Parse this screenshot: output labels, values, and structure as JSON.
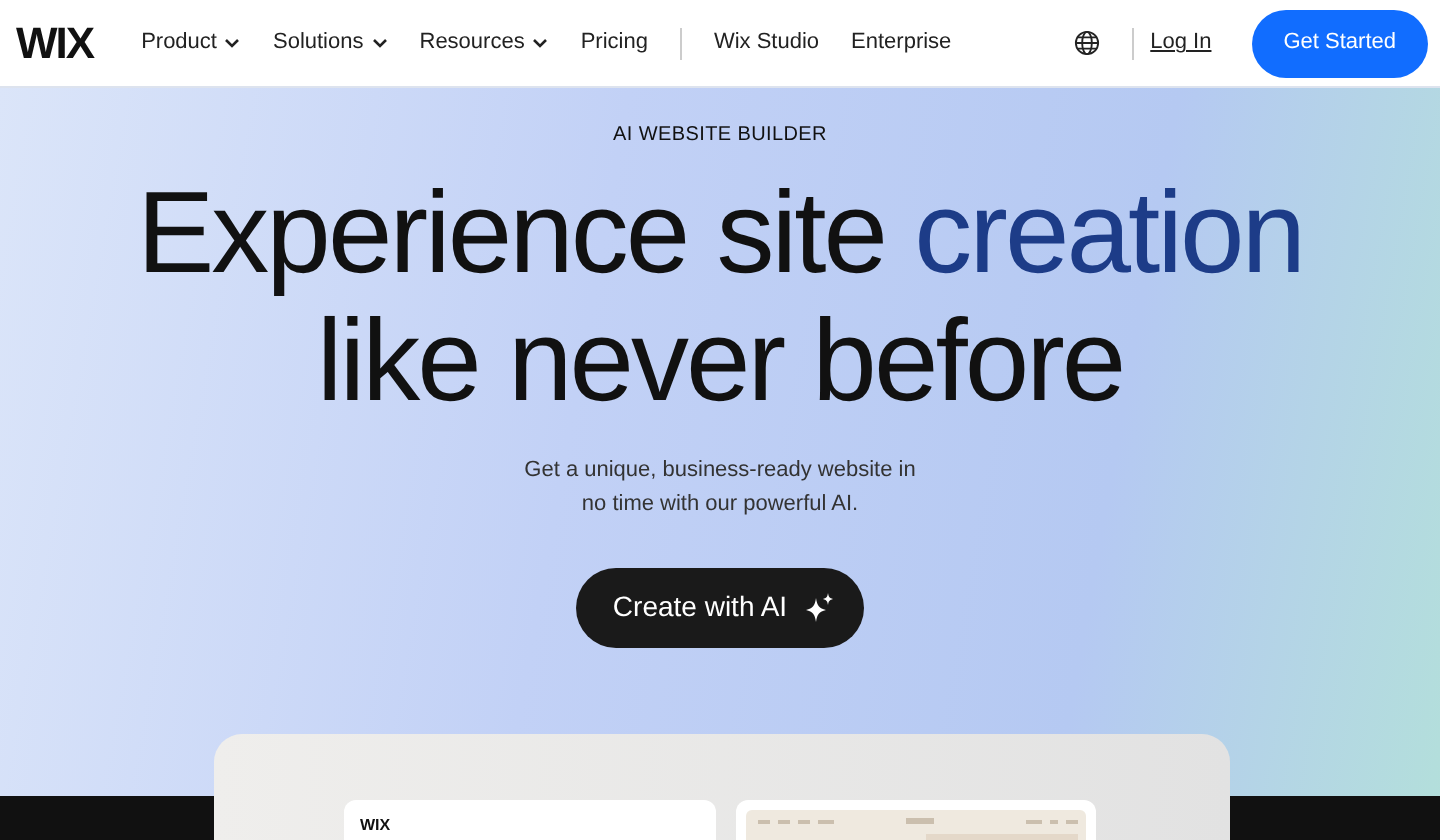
{
  "navbar": {
    "logo": "WIX",
    "menu": [
      {
        "label": "Product",
        "dropdown": true
      },
      {
        "label": "Solutions",
        "dropdown": true
      },
      {
        "label": "Resources",
        "dropdown": true
      },
      {
        "label": "Pricing",
        "dropdown": false
      }
    ],
    "links": [
      "Wix Studio",
      "Enterprise"
    ],
    "login": "Log In",
    "cta": "Get Started"
  },
  "hero": {
    "eyebrow": "AI WEBSITE BUILDER",
    "headline_start": "Experience site ",
    "headline_accent": "creation",
    "headline_end": "like never before",
    "subtitle": "Get a unique, business-ready website in no time with our powerful AI.",
    "button": "Create with AI"
  },
  "preview": {
    "logo": "WIX"
  }
}
